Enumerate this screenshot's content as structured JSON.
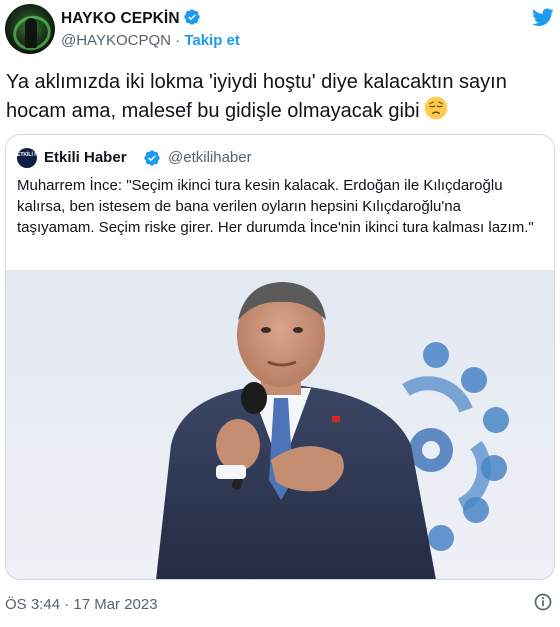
{
  "author": {
    "name": "HAYKO CEPKİN",
    "handle": "@HAYKOCPQN",
    "separator": "·",
    "follow_label": "Takip et"
  },
  "tweet": {
    "text": "Ya aklımızda iki lokma 'iyiydi hoştu' diye kalacaktın sayın hocam ama, malesef bu gidişle olmayacak gibi",
    "emoji": "pensive-face-emoji"
  },
  "quoted": {
    "avatar_text": "ETKİLİ HABER",
    "name": "Etkili Haber",
    "handle": "@etkilihaber",
    "text": "Muharrem İnce: \"Seçim ikinci tura kesin kalacak. Erdoğan ile Kılıçdaroğlu kalırsa, ben istesem de bana verilen oyların hepsini Kılıçdaroğlu'na taşıyamam. Seçim riske girer. Her durumda İnce'nin ikinci tura kalması lazım.\"",
    "image_description_icon": "speaker-at-podium-photo"
  },
  "footer": {
    "timestamp": "ÖS 3:44 · 17 Mar 2023"
  },
  "icons": {
    "verified": "verified-badge-icon",
    "brand": "twitter-bird-icon",
    "info": "info-icon"
  },
  "colors": {
    "accent": "#1d9bf0",
    "muted": "#536471",
    "border": "#cfd9de"
  }
}
